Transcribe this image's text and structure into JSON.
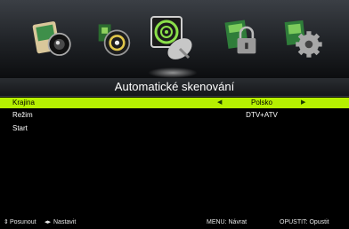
{
  "icons": [
    {
      "name": "picture-icon"
    },
    {
      "name": "sound-icon"
    },
    {
      "name": "channel-search-icon"
    },
    {
      "name": "lock-icon"
    },
    {
      "name": "setup-gear-icon"
    }
  ],
  "title": "Automatické skenování",
  "menu": {
    "rows": [
      {
        "label": "Krajina",
        "value": "Polsko"
      },
      {
        "label": "Režim",
        "value": "DTV+ATV"
      },
      {
        "label": "Start",
        "value": ""
      }
    ]
  },
  "hints": {
    "move": "Posunout",
    "set": "Nastavit",
    "back": "MENU: Návrat",
    "exit": "OPUSTIT: Opustit"
  },
  "colors": {
    "highlight": "#b6f001",
    "background": "#000000"
  }
}
